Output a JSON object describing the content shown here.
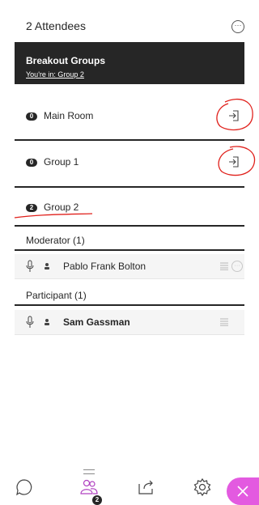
{
  "header": {
    "title": "2 Attendees",
    "more_icon": "more-circle-icon"
  },
  "breakout": {
    "title": "Breakout Groups",
    "current_group": "You're in: Group 2"
  },
  "groups": [
    {
      "count": "0",
      "name": "Main Room",
      "join_icon": "enter-room-icon"
    },
    {
      "count": "0",
      "name": "Group 1",
      "join_icon": "enter-room-icon"
    },
    {
      "count": "2",
      "name": "Group 2"
    }
  ],
  "moderators": {
    "label": "Moderator (1)",
    "people": [
      {
        "name": "Pablo Frank Bolton"
      }
    ]
  },
  "participants": {
    "label": "Participant (1)",
    "people": [
      {
        "name": "Sam Gassman"
      }
    ]
  },
  "bottom_bar": {
    "tabs": [
      "chat-icon",
      "attendees-icon",
      "share-icon",
      "settings-icon"
    ],
    "attendee_count": "2",
    "close_icon": "close-icon"
  },
  "colors": {
    "dark": "#262626",
    "accent": "#e35ae0",
    "annotation": "#e0201b"
  }
}
